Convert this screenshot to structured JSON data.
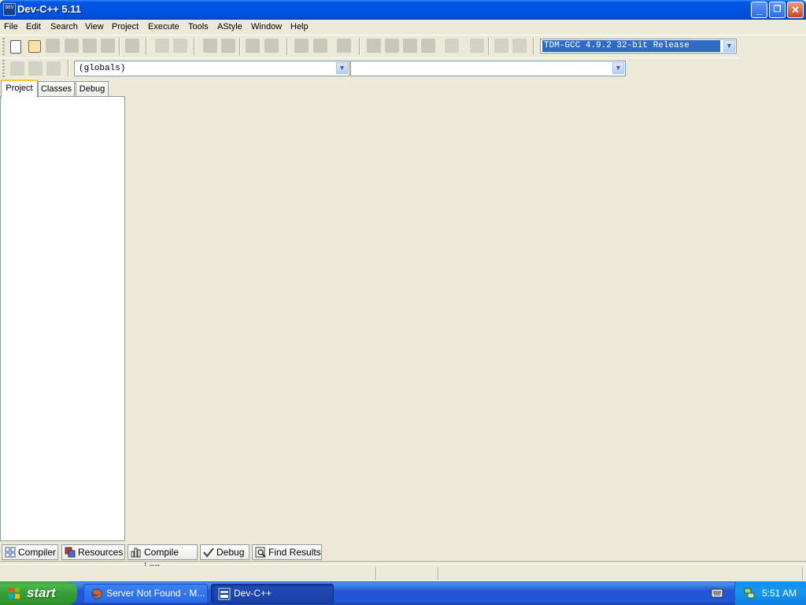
{
  "window": {
    "app_icon_text": "DEV",
    "title": "Dev-C++ 5.11",
    "controls": {
      "minimize": "_",
      "restore": "❐",
      "close": "✕"
    }
  },
  "menu": {
    "items": [
      {
        "label": "File"
      },
      {
        "label": "Edit"
      },
      {
        "label": "Search"
      },
      {
        "label": "View"
      },
      {
        "label": "Project"
      },
      {
        "label": "Execute"
      },
      {
        "label": "Tools"
      },
      {
        "label": "AStyle"
      },
      {
        "label": "Window"
      },
      {
        "label": "Help"
      }
    ]
  },
  "toolbar": {
    "compiler_selected": "TDM-GCC 4.9.2 32-bit Release",
    "scope_selected": "(globals)",
    "function_selected": ""
  },
  "left_panel": {
    "tabs": [
      {
        "label": "Project",
        "active": true
      },
      {
        "label": "Classes",
        "active": false
      },
      {
        "label": "Debug",
        "active": false
      }
    ]
  },
  "bottom_tabs": [
    {
      "label": "Compiler",
      "icon": "grid-icon"
    },
    {
      "label": "Resources",
      "icon": "resources-icon"
    },
    {
      "label": "Compile Log",
      "icon": "bar-chart-icon"
    },
    {
      "label": "Debug",
      "icon": "checkmark-icon"
    },
    {
      "label": "Find Results",
      "icon": "magnifier-icon"
    }
  ],
  "taskbar": {
    "start_label": "start",
    "tasks": [
      {
        "label": "Server Not Found - M...",
        "icon": "firefox-icon",
        "active": false
      },
      {
        "label": "Dev-C++",
        "icon": "devcpp-icon",
        "active": true
      }
    ],
    "clock": "5:51 AM"
  },
  "colors": {
    "titlebar": "#0053e0",
    "window_bg": "#ece9d8",
    "selection": "#316ac5",
    "start_green": "#35a035",
    "taskbar_blue": "#2157d7"
  }
}
